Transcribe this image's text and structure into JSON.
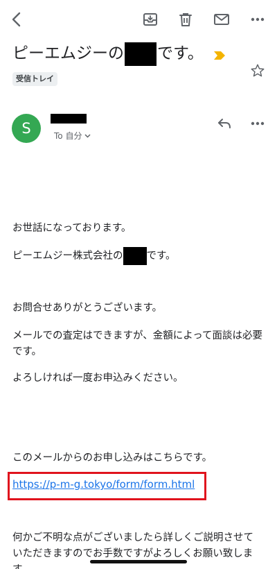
{
  "toolbar": {
    "icons": [
      "back-icon",
      "archive-icon",
      "trash-icon",
      "mail-icon",
      "more-icon"
    ]
  },
  "email": {
    "subject_before": "ピーエムジーの",
    "subject_after": "です。",
    "label": "受信トレイ",
    "avatar_letter": "S",
    "recipient": "To 自分",
    "body": {
      "greeting": "お世話になっております。",
      "company_before": "ピーエムジー株式会社の",
      "company_after": "です。",
      "thanks": "お問合せありがとうございます。",
      "assessment": "メールでの査定はできますが、金額によって面談は必要です。",
      "request": "よろしければ一度お申込みください。",
      "link_intro": "このメールからのお申し込みはこちらです。",
      "link": "https://p-m-g.tokyo/form/form.html",
      "closing": "何かご不明な点がございましたら詳しくご説明させていただきますのでお手数ですがよろしくお願い致します。"
    }
  },
  "colors": {
    "avatar": "#34a853",
    "link": "#1a73e8",
    "highlight_box": "#e0131d",
    "important_marker": "#f4b400"
  }
}
